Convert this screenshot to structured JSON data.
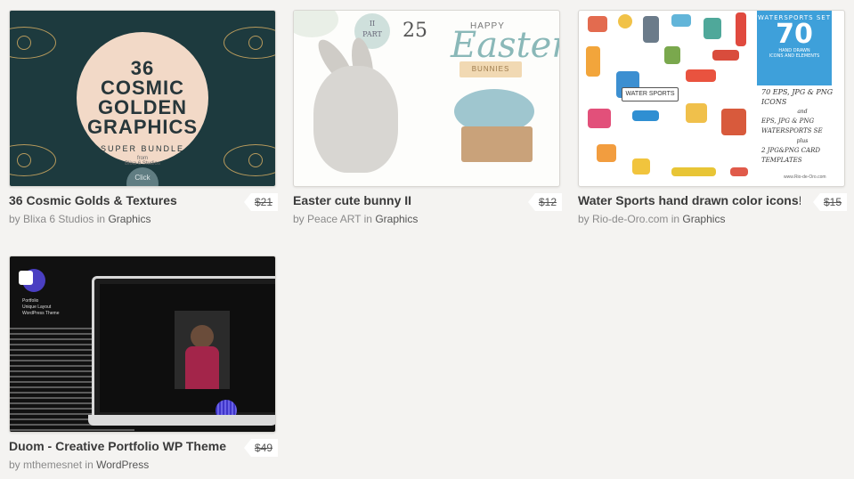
{
  "cards": [
    {
      "title": "36 Cosmic Golds & Textures",
      "price": "$21",
      "by_prefix": "by",
      "author": "Blixa 6 Studios",
      "in_word": "in",
      "category": "Graphics",
      "thumb": {
        "line1": "36",
        "line2": "COSMIC",
        "line3": "GOLDEN",
        "line4": "GRAPHICS",
        "sub": "SUPER BUNDLE",
        "from": "from",
        "studio": "Blixa 6 Studios",
        "click": "Click"
      }
    },
    {
      "title": "Easter cute bunny II",
      "price": "$12",
      "by_prefix": "by",
      "author": "Peace ART",
      "in_word": "in",
      "category": "Graphics",
      "thumb": {
        "part_num": "II",
        "part": "PART",
        "count": "25",
        "happy": "HAPPY",
        "easter": "Easter",
        "bunnies": "BUNNIES"
      }
    },
    {
      "title": "Water Sports hand drawn color icons!",
      "price": "$15",
      "by_prefix": "by",
      "author": "Rio-de-Oro.com",
      "in_word": "in",
      "category": "Graphics",
      "thumb": {
        "set": "WATERSPORTS SET",
        "num": "70",
        "hand": "HAND DRAWN",
        "icons": "ICONS AND ELEMENTS",
        "label": "WATER SPORTS",
        "l1": "70 EPS, JPG & PNG ICONS",
        "l2": "and",
        "l3": "EPS, JPG & PNG WATERSPORTS SE",
        "l4": "plus",
        "l5": "2 JPG&PNG CARD TEMPLATES",
        "url": "www.Rio-de-Oro.com"
      }
    },
    {
      "title": "Duom - Creative Portfolio WP Theme",
      "price": "$49",
      "by_prefix": "by",
      "author": "mthemesnet",
      "in_word": "in",
      "category": "WordPress",
      "thumb": {
        "side1": "Portfolio",
        "side2": "Unique Layout",
        "side3": "WordPress Theme"
      }
    }
  ]
}
